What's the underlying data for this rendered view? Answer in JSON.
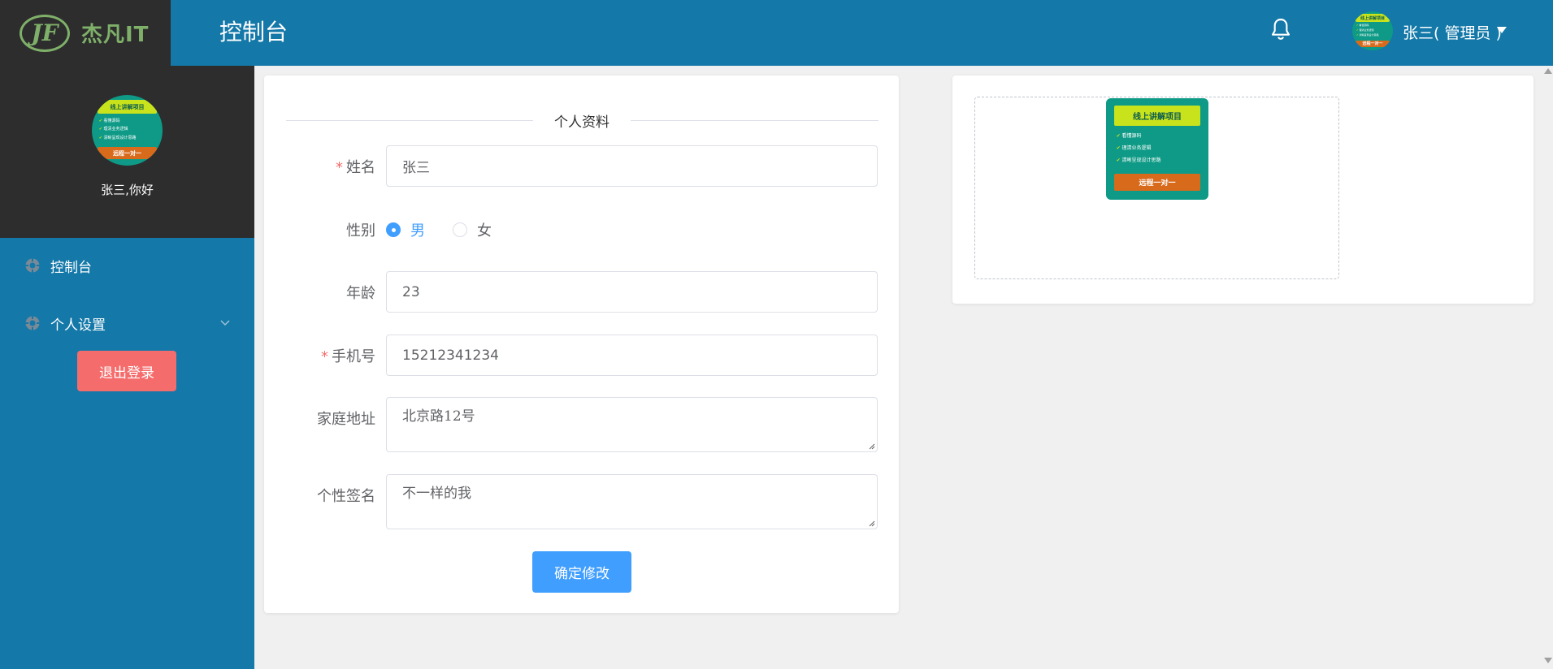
{
  "brand": {
    "logo_mark": "JF",
    "logo_text": "杰凡IT"
  },
  "header": {
    "title": "控制台",
    "user_label": "张三( 管理员 )"
  },
  "sidebar": {
    "greeting": "张三,你好",
    "items": [
      {
        "label": "控制台",
        "icon": "gear-icon"
      },
      {
        "label": "个人设置",
        "icon": "gear-icon",
        "has_submenu": true
      }
    ],
    "logout_label": "退出登录"
  },
  "promo": {
    "title": "线上讲解项目",
    "lines": [
      "看懂源码",
      "理清业务逻辑",
      "清晰呈现设计思路"
    ],
    "footer": "远程一对一"
  },
  "form": {
    "section_title": "个人资料",
    "name": {
      "label": "姓名",
      "required": true,
      "value": "张三"
    },
    "gender": {
      "label": "性别",
      "options": [
        "男",
        "女"
      ],
      "selected": "男"
    },
    "age": {
      "label": "年龄",
      "value": "23"
    },
    "phone": {
      "label": "手机号",
      "required": true,
      "value": "15212341234"
    },
    "address": {
      "label": "家庭地址",
      "value": "北京路12号"
    },
    "signature": {
      "label": "个性签名",
      "value": "不一样的我"
    },
    "submit_label": "确定修改"
  },
  "colors": {
    "header_bg": "#1478a8",
    "dark_panel": "#2d2d2d",
    "primary": "#409eff",
    "danger": "#f56c6c",
    "logo_green": "#7fb069"
  }
}
